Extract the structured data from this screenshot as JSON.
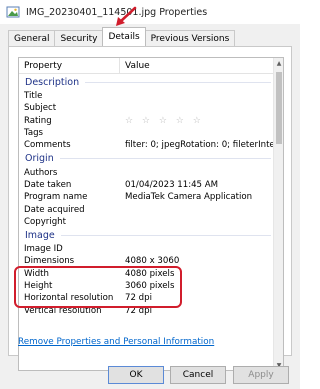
{
  "window": {
    "title": "IMG_20230401_114501.jpg Properties"
  },
  "tabs": [
    {
      "label": "General"
    },
    {
      "label": "Security"
    },
    {
      "label": "Details"
    },
    {
      "label": "Previous Versions"
    }
  ],
  "list": {
    "header": {
      "property": "Property",
      "value": "Value"
    },
    "sections": {
      "description": "Description",
      "origin": "Origin",
      "image": "Image"
    },
    "description": [
      {
        "property": "Title",
        "value": ""
      },
      {
        "property": "Subject",
        "value": ""
      },
      {
        "property": "Rating",
        "value": "☆ ☆ ☆ ☆ ☆"
      },
      {
        "property": "Tags",
        "value": ""
      },
      {
        "property": "Comments",
        "value": "filter: 0; jpegRotation: 0; fileterInte..."
      }
    ],
    "origin": [
      {
        "property": "Authors",
        "value": ""
      },
      {
        "property": "Date taken",
        "value": "01/04/2023 11:45 AM"
      },
      {
        "property": "Program name",
        "value": "MediaTek Camera Application"
      },
      {
        "property": "Date acquired",
        "value": ""
      },
      {
        "property": "Copyright",
        "value": ""
      }
    ],
    "image": [
      {
        "property": "Image ID",
        "value": ""
      },
      {
        "property": "Dimensions",
        "value": "4080 x 3060"
      },
      {
        "property": "Width",
        "value": "4080 pixels"
      },
      {
        "property": "Height",
        "value": "3060 pixels"
      },
      {
        "property": "Horizontal resolution",
        "value": "72 dpi"
      },
      {
        "property": "Vertical resolution",
        "value": "72 dpi"
      }
    ]
  },
  "links": {
    "remove": "Remove Properties and Personal Information"
  },
  "buttons": {
    "ok": "OK",
    "cancel": "Cancel",
    "apply": "Apply"
  },
  "colors": {
    "highlight": "#d11d2c",
    "section_text": "#1e3287",
    "link": "#0066cc"
  }
}
